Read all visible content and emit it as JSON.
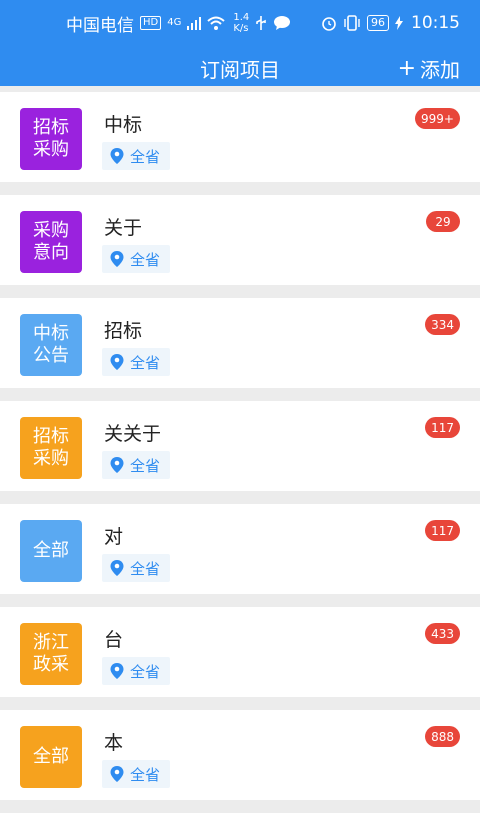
{
  "colors": {
    "brand": "#2f8cf0",
    "badge": "#e8463a",
    "purple": "#9a22de",
    "light_blue": "#5aa9f2",
    "orange": "#f6a21e"
  },
  "status_bar": {
    "carrier": "中国电信",
    "hd": "HD",
    "network": "4G",
    "speed_value": "1.4",
    "speed_unit": "K/s",
    "battery": "96",
    "time": "10:15"
  },
  "header": {
    "title": "订阅项目",
    "add_icon": "plus-icon",
    "add_label": "添加"
  },
  "items": [
    {
      "tag": "招标\n采购",
      "tag_color": "#9a22de",
      "title": "中标",
      "region": "全省",
      "badge": "999+"
    },
    {
      "tag": "采购\n意向",
      "tag_color": "#9a22de",
      "title": "关于",
      "region": "全省",
      "badge": "29"
    },
    {
      "tag": "中标\n公告",
      "tag_color": "#5aa9f2",
      "title": "招标",
      "region": "全省",
      "badge": "334"
    },
    {
      "tag": "招标\n采购",
      "tag_color": "#f6a21e",
      "title": "关关于",
      "region": "全省",
      "badge": "117"
    },
    {
      "tag": "全部",
      "tag_color": "#5aa9f2",
      "title": "对",
      "region": "全省",
      "badge": "117"
    },
    {
      "tag": "浙江\n政采",
      "tag_color": "#f6a21e",
      "title": "台",
      "region": "全省",
      "badge": "433"
    },
    {
      "tag": "全部",
      "tag_color": "#f6a21e",
      "title": "本",
      "region": "全省",
      "badge": "888"
    }
  ]
}
